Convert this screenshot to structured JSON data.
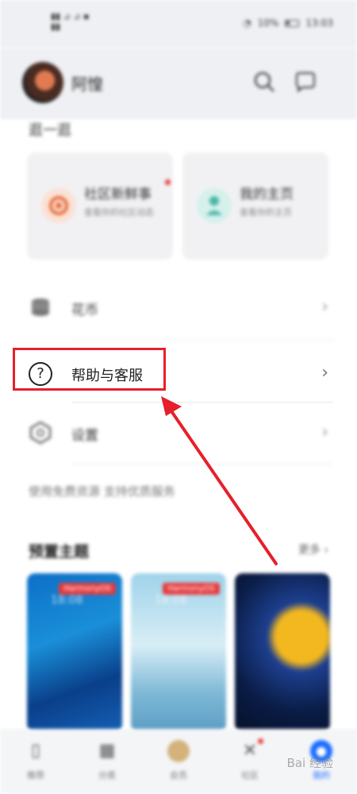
{
  "status_bar": {
    "carrier": "...",
    "battery_percent": "10%",
    "time": "13:03"
  },
  "header": {
    "username": "阿惶",
    "search_icon": "search-icon",
    "message_icon": "message-icon"
  },
  "section": {
    "label": "逛一逛"
  },
  "cards": [
    {
      "title": "社区新鲜事",
      "subtitle": "查看你的社区动态"
    },
    {
      "title": "我的主页",
      "subtitle": "查看你的主页"
    }
  ],
  "rows": {
    "coins": {
      "label": "花币"
    },
    "help": {
      "label": "帮助与客服"
    },
    "settings": {
      "label": "设置"
    }
  },
  "footer_note": "使用免费资源 支持优质服务",
  "preset": {
    "title": "预置主题",
    "more": "更多",
    "badge": "HarmonyOS",
    "time": "18:08"
  },
  "nav": [
    {
      "label": "推荐",
      "icon": "recommend-icon"
    },
    {
      "label": "分类",
      "icon": "grid-icon"
    },
    {
      "label": "会员",
      "icon": "member-icon"
    },
    {
      "label": "社区",
      "icon": "community-icon"
    },
    {
      "label": "我的",
      "icon": "profile-icon"
    }
  ],
  "watermark": "Bai 经验",
  "colors": {
    "highlight": "#e5202a",
    "accent": "#1a6dff"
  }
}
